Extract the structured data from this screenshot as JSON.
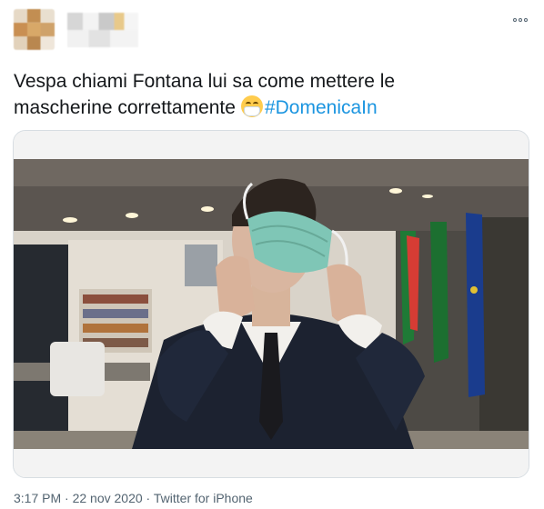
{
  "tweet": {
    "text_line1": "Vespa chiami Fontana lui sa come mettere le",
    "text_line2": "mascherine correttamente",
    "hashtag": "#DomenicaIn",
    "emoji": "face-with-medical-mask-icon"
  },
  "meta": {
    "time": "3:17 PM",
    "separator1": " · ",
    "date": "22 nov 2020",
    "separator2": " · ",
    "source": "Twitter for iPhone"
  },
  "colors": {
    "text": "#14171a",
    "hashtag": "#1b95e0",
    "meta": "#536471",
    "card_border": "#d7dde2"
  },
  "media": {
    "description": "photo"
  }
}
